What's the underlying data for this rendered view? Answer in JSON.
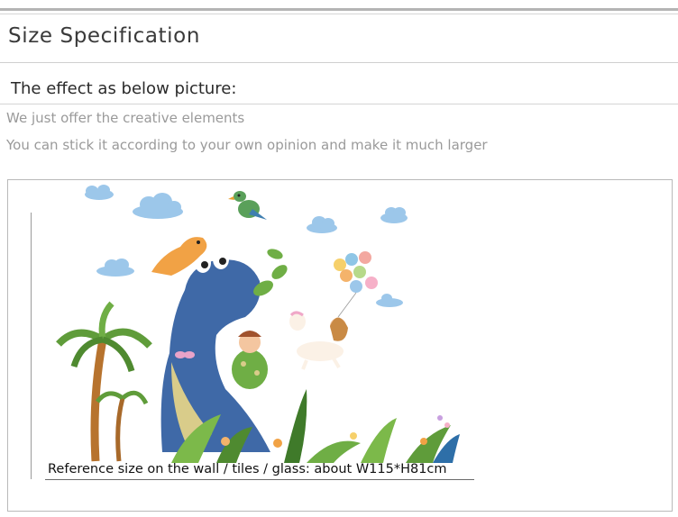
{
  "header": {
    "title": "Size Specification"
  },
  "effect": {
    "heading": "The effect as below picture:",
    "lines": [
      "We just offer the creative elements",
      "You can stick it according to your own opinion and make it much larger"
    ]
  },
  "picture": {
    "caption": "Reference size on the wall / tiles / glass: about  W115*H81cm"
  },
  "colors": {
    "dinosaur": "#3f69a7",
    "dinosaur_belly": "#d9cc8a",
    "small_dino": "#f1a245",
    "cloud": "#9cc7ea",
    "palm_leaf": "#5f9c3a",
    "palm_trunk": "#b7732e"
  }
}
